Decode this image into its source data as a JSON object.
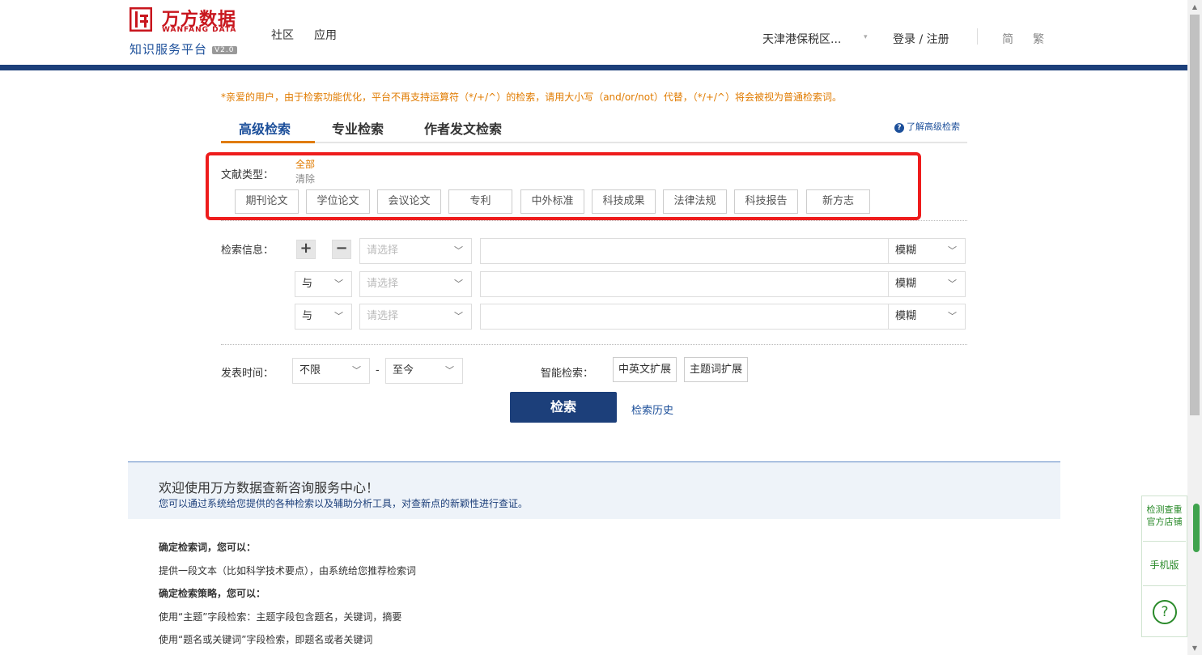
{
  "header": {
    "logo_name": "万方数据",
    "logo_en": "WANFANG DATA",
    "logo_sub": "知识服务平台",
    "logo_version": "V2.0",
    "nav": [
      "社区",
      "应用"
    ],
    "location": "天津港保税区...",
    "login": "登录 / 注册",
    "lang_simplified": "简",
    "lang_traditional": "繁"
  },
  "notice": "*亲爱的用户，由于检索功能优化，平台不再支持运算符（*/+/^）的检索，请用大小写（and/or/not）代替，（*/+/^）将会被视为普通检索词。",
  "tabs": [
    "高级检索",
    "专业检索",
    "作者发文检索"
  ],
  "help_link": "了解高级检索",
  "doc_type": {
    "label": "文献类型：",
    "all": "全部",
    "clear": "清除",
    "types": [
      "期刊论文",
      "学位论文",
      "会议论文",
      "专利",
      "中外标准",
      "科技成果",
      "法律法规",
      "科技报告",
      "新方志"
    ]
  },
  "search_info": {
    "label": "检索信息：",
    "plus": "+",
    "minus": "−",
    "field_placeholder": "请选择",
    "logic": "与",
    "match": "模糊"
  },
  "date": {
    "label": "发表时间：",
    "from": "不限",
    "dash": "-",
    "to": "至今"
  },
  "smart": {
    "label": "智能检索：",
    "buttons": [
      "中英文扩展",
      "主题词扩展"
    ]
  },
  "search_button": "检索",
  "history_link": "检索历史",
  "welcome": {
    "title": "欢迎使用万方数据查新咨询服务中心！",
    "subtitle": "您可以通过系统给您提供的各种检索以及辅助分析工具，对查新点的新颖性进行查证。"
  },
  "help_lines": [
    {
      "text": "确定检索词，您可以：",
      "bold": true
    },
    {
      "text": "提供一段文本（比如科学技术要点），由系统给您推荐检索词",
      "bold": false
    },
    {
      "text": "确定检索策略，您可以：",
      "bold": true
    },
    {
      "text": "使用“主题”字段检索：主题字段包含题名，关键词，摘要",
      "bold": false
    },
    {
      "text": "使用“题名或关键词”字段检索，即题名或者关键词",
      "bold": false
    }
  ],
  "side": {
    "store": "检测查重官方店铺",
    "mobile": "手机版",
    "help": "?"
  },
  "colors": {
    "brand_red": "#c8151d",
    "brand_blue": "#1c3f7a",
    "accent_orange": "#e07b00",
    "highlight_red": "#ee1c1c"
  }
}
